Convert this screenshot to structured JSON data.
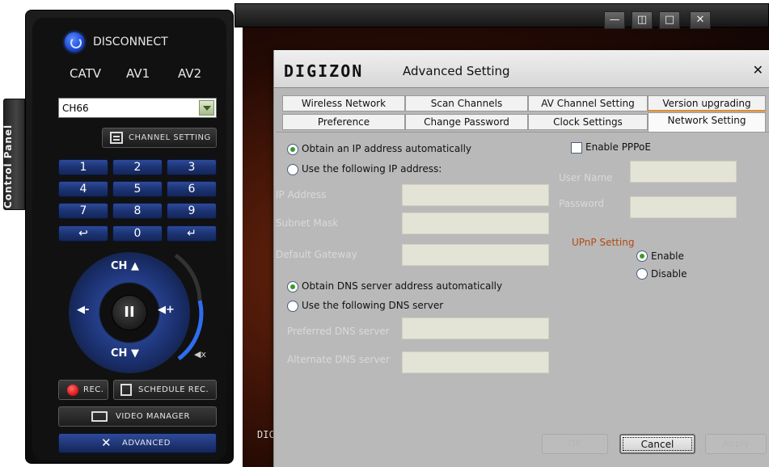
{
  "control_panel": {
    "tab_label": "Control Panel",
    "disconnect_label": "DISCONNECT",
    "sources": [
      "CATV",
      "AV1",
      "AV2"
    ],
    "channel_value": "CH66",
    "channel_setting_label": "CHANNEL SETTING",
    "keypad": [
      "1",
      "2",
      "3",
      "4",
      "5",
      "6",
      "7",
      "8",
      "9",
      "↩",
      "0",
      "↵"
    ],
    "dial": {
      "ch_up": "CH ▲",
      "ch_down": "CH ▼",
      "vol_down": "◀-",
      "vol_up": "◀+",
      "pause": "II"
    },
    "rec_label": "REC.",
    "schedule_label": "SCHEDULE REC.",
    "video_manager_label": "VIDEO MANAGER",
    "advanced_label": "ADVANCED"
  },
  "player": {
    "overlay_text": "DIC",
    "window_buttons": [
      "—",
      "◫",
      "□",
      "✕"
    ]
  },
  "dialog": {
    "logo": "DIGIZON",
    "title": "Advanced Setting",
    "close": "✕",
    "tabs_row1": [
      "Wireless Network",
      "Scan Channels",
      "AV Channel Setting",
      "Version upgrading"
    ],
    "tabs_row2": [
      "Preference",
      "Change Password",
      "Clock Settings",
      "Network Setting"
    ],
    "active_tab": "Network Setting",
    "ip": {
      "auto_label": "Obtain an IP address automatically",
      "manual_label": "Use the following IP address:",
      "ip_label": "IP Address",
      "subnet_label": "Subnet Mask",
      "gateway_label": "Default Gateway",
      "selected": "auto"
    },
    "dns": {
      "auto_label": "Obtain DNS server address automatically",
      "manual_label": "Use the following DNS server",
      "preferred_label": "Preferred DNS server",
      "alternate_label": "Alternate DNS server",
      "selected": "auto"
    },
    "pppoe": {
      "enable_label": "Enable PPPoE",
      "checked": false,
      "user_label": "User Name",
      "password_label": "Password"
    },
    "upnp": {
      "title": "UPnP Setting",
      "enable_label": "Enable",
      "disable_label": "Disable",
      "selected": "enable"
    },
    "buttons": {
      "ok": "OK",
      "cancel": "Cancel",
      "apply": "Apply"
    }
  }
}
